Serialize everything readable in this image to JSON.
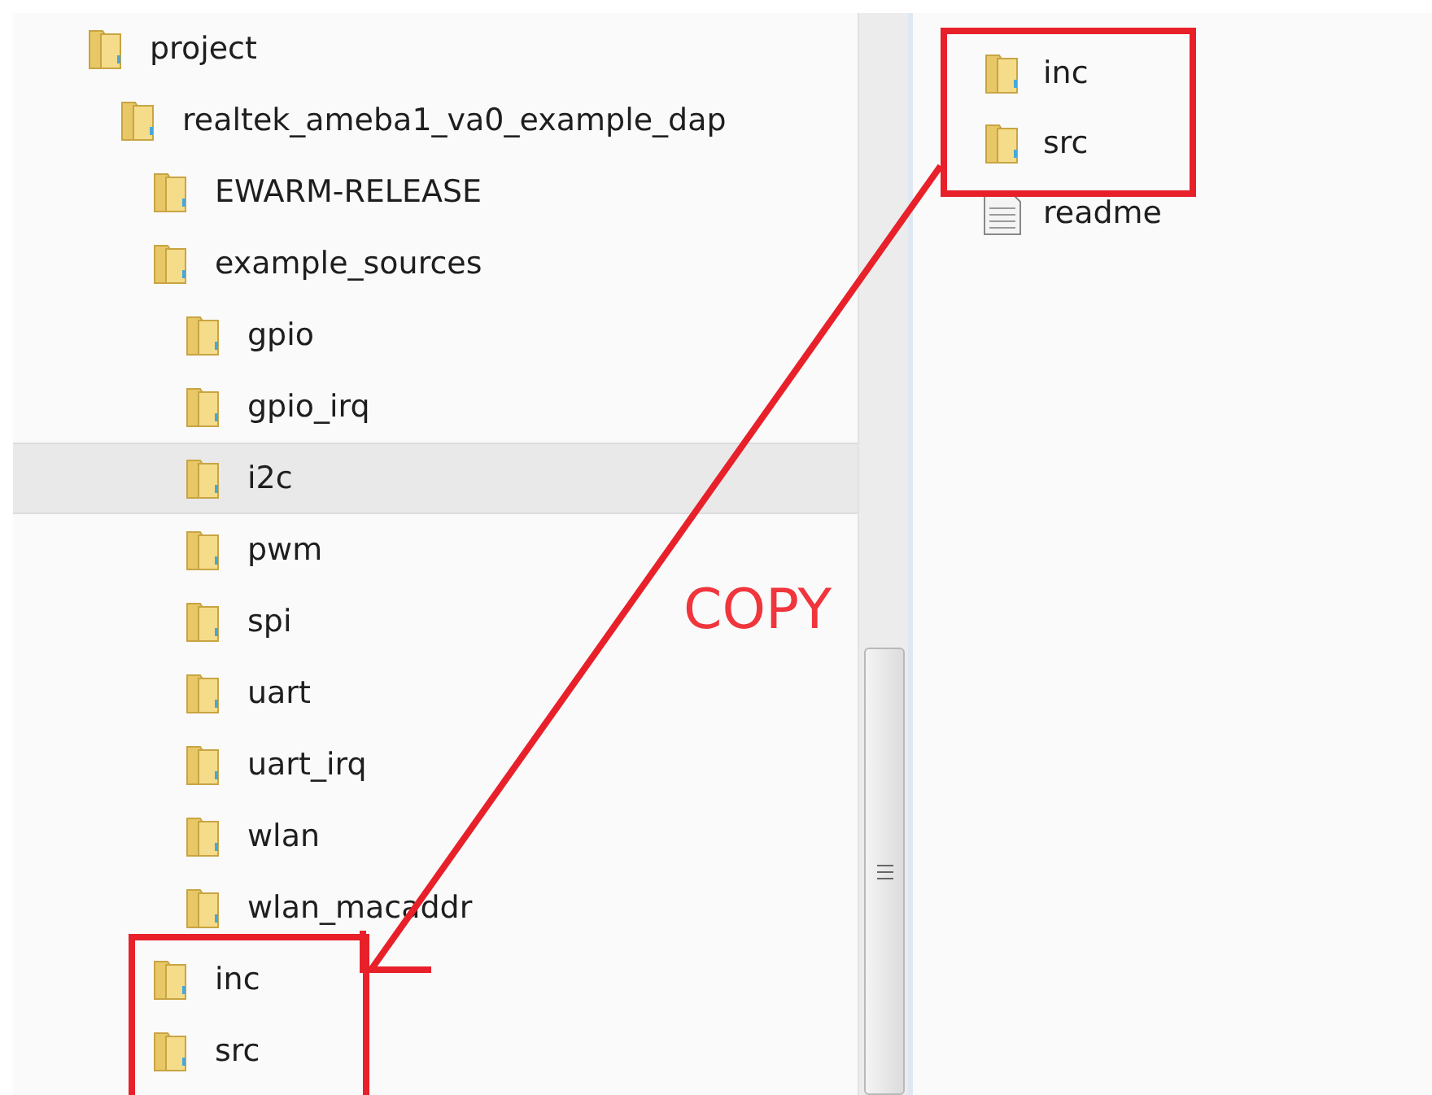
{
  "tree": [
    {
      "label": "project",
      "selected": false,
      "children": [
        {
          "label": "realtek_ameba1_va0_example_dap",
          "selected": false,
          "children": [
            {
              "label": "EWARM-RELEASE",
              "selected": false
            },
            {
              "label": "example_sources",
              "selected": false,
              "children": [
                {
                  "label": "gpio",
                  "selected": false
                },
                {
                  "label": "gpio_irq",
                  "selected": false
                },
                {
                  "label": "i2c",
                  "selected": true
                },
                {
                  "label": "pwm",
                  "selected": false
                },
                {
                  "label": "spi",
                  "selected": false
                },
                {
                  "label": "uart",
                  "selected": false
                },
                {
                  "label": "uart_irq",
                  "selected": false
                },
                {
                  "label": "wlan",
                  "selected": false
                },
                {
                  "label": "wlan_macaddr",
                  "selected": false
                }
              ]
            },
            {
              "label": "inc",
              "selected": false
            },
            {
              "label": "src",
              "selected": false
            }
          ]
        }
      ]
    }
  ],
  "files": [
    {
      "label": "inc",
      "kind": "folder"
    },
    {
      "label": "src",
      "kind": "folder"
    },
    {
      "label": "readme",
      "kind": "file"
    }
  ],
  "annotation": {
    "text": "COPY"
  }
}
